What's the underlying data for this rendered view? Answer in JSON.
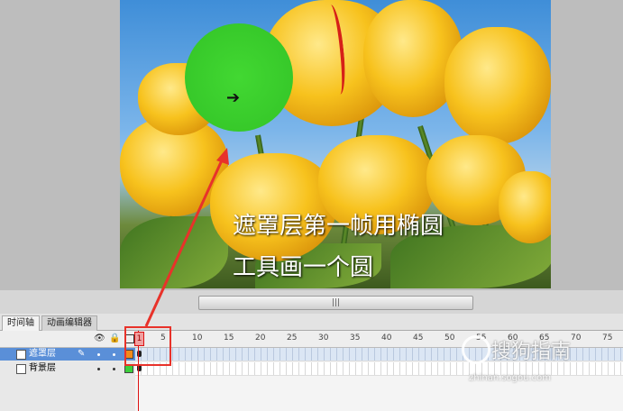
{
  "stage": {
    "caption_line1": "遮罩层第一帧用椭圆",
    "caption_line2": "工具画一个圆",
    "circle_color": "#37c92a",
    "annotation_color": "#e8322a"
  },
  "scrollbar": {
    "grip": "|||"
  },
  "timeline": {
    "tabs": [
      {
        "label": "时间轴",
        "active": true
      },
      {
        "label": "动画编辑器",
        "active": false
      }
    ],
    "header_icons": [
      "eye-icon",
      "lock-icon",
      "outline-icon"
    ],
    "current_frame": "1",
    "ruler": [
      "5",
      "10",
      "15",
      "20",
      "25",
      "30",
      "35",
      "40",
      "45",
      "50",
      "55",
      "60",
      "65",
      "70",
      "75"
    ],
    "layers": [
      {
        "name": "遮罩层",
        "selected": true,
        "color": "#f28a1a"
      },
      {
        "name": "背景层",
        "selected": false,
        "color": "#3ccf3c"
      }
    ]
  },
  "watermark": {
    "text": "搜狗指南",
    "url": "zhinan.sogou.com"
  }
}
